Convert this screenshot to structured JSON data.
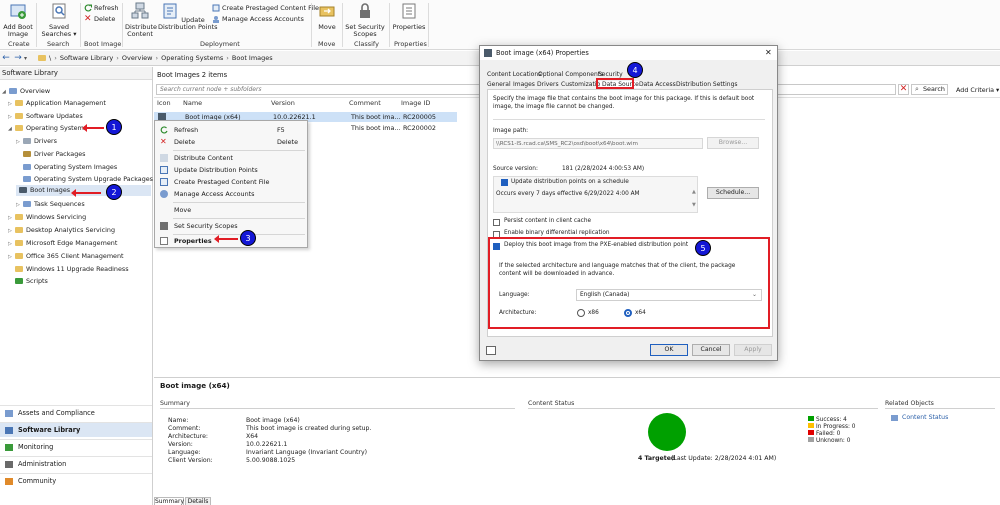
{
  "ribbon": {
    "add_boot_image": "Add Boot\nImage",
    "saved_searches": "Saved\nSearches ▾",
    "refresh": "Refresh",
    "delete": "Delete",
    "distribute_content": "Distribute\nContent",
    "update_distribution_points": "Update\nDistribution Points",
    "create_prestaged": "Create Prestaged Content File",
    "manage_access": "Manage Access Accounts",
    "move": "Move",
    "set_security_scopes": "Set Security\nScopes",
    "properties": "Properties",
    "groups": [
      "Create",
      "Search",
      "Boot Image",
      "Deployment",
      "Move",
      "Classify",
      "Properties"
    ]
  },
  "nav": {
    "back": "←",
    "forward": "→",
    "breadcrumbs": [
      "\\",
      "Software Library",
      "Overview",
      "Operating Systems",
      "Boot Images"
    ]
  },
  "left_panel": {
    "header": "Software Library",
    "tree": [
      "Overview",
      "Application Management",
      "Software Updates",
      "Operating Systems",
      "Drivers",
      "Driver Packages",
      "Operating System Images",
      "Operating System Upgrade Packages",
      "Boot Images",
      "Task Sequences",
      "Windows Servicing",
      "Desktop Analytics Servicing",
      "Microsoft Edge Management",
      "Office 365 Client Management",
      "Windows 11 Upgrade Readiness",
      "Scripts"
    ],
    "workspaces": [
      "Assets and Compliance",
      "Software Library",
      "Monitoring",
      "Administration",
      "Community"
    ]
  },
  "center": {
    "title": "Boot Images 2 items",
    "search_placeholder": "Search current node + subfolders",
    "search_button": "Search",
    "add_criteria": "Add Criteria ▾",
    "columns": [
      "Icon",
      "Name",
      "Version",
      "Comment",
      "Image ID"
    ],
    "rows": [
      {
        "name": "Boot image (x64)",
        "version": "10.0.22621.1",
        "comment": "This boot ima...",
        "image_id": "RC200005"
      },
      {
        "name": "",
        "version": "",
        "comment": "This boot ima...",
        "image_id": "RC200002"
      }
    ]
  },
  "context_menu": {
    "items": [
      {
        "label": "Refresh",
        "shortcut": "F5"
      },
      {
        "label": "Delete",
        "shortcut": "Delete"
      },
      {
        "label": "Distribute Content",
        "shortcut": ""
      },
      {
        "label": "Update Distribution Points",
        "shortcut": ""
      },
      {
        "label": "Create Prestaged Content File",
        "shortcut": ""
      },
      {
        "label": "Manage Access Accounts",
        "shortcut": ""
      },
      {
        "label": "Move",
        "shortcut": ""
      },
      {
        "label": "Set Security Scopes",
        "shortcut": ""
      },
      {
        "label": "Properties",
        "shortcut": ""
      }
    ]
  },
  "details": {
    "title": "Boot image (x64)",
    "summary_label": "Summary",
    "fields": [
      {
        "k": "Name:",
        "v": "Boot image (x64)"
      },
      {
        "k": "Comment:",
        "v": "This boot image is created during setup."
      },
      {
        "k": "Architecture:",
        "v": "X64"
      },
      {
        "k": "Version:",
        "v": "10.0.22621.1"
      },
      {
        "k": "Language:",
        "v": "Invariant Language (Invariant Country)"
      },
      {
        "k": "Client Version:",
        "v": "5.00.9088.1025"
      }
    ],
    "content_status_label": "Content Status",
    "targeted": "4 Targeted",
    "last_update": "(Last Update: 2/28/2024 4:01 AM)",
    "legend": [
      {
        "label": "Success: 4",
        "color": "#00a000"
      },
      {
        "label": "In Progress: 0",
        "color": "#ffc000"
      },
      {
        "label": "Failed: 0",
        "color": "#e00000"
      },
      {
        "label": "Unknown: 0",
        "color": "#a0a0a0"
      }
    ],
    "related_label": "Related Objects",
    "related_link": "Content Status",
    "tabs": [
      "Summary",
      "Details"
    ],
    "success_color": "#00a000"
  },
  "dialog": {
    "title": "Boot image (x64) Properties",
    "tabs_row1": [
      "Content Locations",
      "Optional Components",
      "Security"
    ],
    "tabs_row2": [
      "General",
      "Images",
      "Drivers",
      "Customization",
      "Data Source",
      "Data Access",
      "Distribution Settings"
    ],
    "intro": "Specify the image file that contains the boot image for this package. If this is default boot image, the image file cannot be changed.",
    "image_path_label": "Image path:",
    "image_path_value": "\\\\RCS1-IS.rcad.ca\\SMS_RC2\\osd\\boot\\x64\\boot.wim",
    "browse": "Browse...",
    "source_version_label": "Source version:",
    "source_version_value": "181 (2/28/2024 4:00:53 AM)",
    "update_dp_schedule": "Update distribution points on a schedule",
    "occurs": "Occurs every 7 days effective 6/29/2022 4:00 AM",
    "schedule": "Schedule...",
    "persist": "Persist content in client cache",
    "binary_diff": "Enable binary differential replication",
    "deploy_pxe": "Deploy this boot image from the PXE-enabled distribution point",
    "arch_note": "If the selected architecture and language matches that of the client, the package content will be downloaded in advance.",
    "language_label": "Language:",
    "language_value": "English (Canada)",
    "architecture_label": "Architecture:",
    "arch_x86": "x86",
    "arch_x64": "x64",
    "ok": "OK",
    "cancel": "Cancel",
    "apply": "Apply",
    "close": "✕"
  },
  "annotations": [
    "1",
    "2",
    "3",
    "4",
    "5"
  ],
  "colors": {
    "annotation": "#1417d6",
    "highlight": "#e11d25",
    "accent": "#1f5fbf"
  }
}
